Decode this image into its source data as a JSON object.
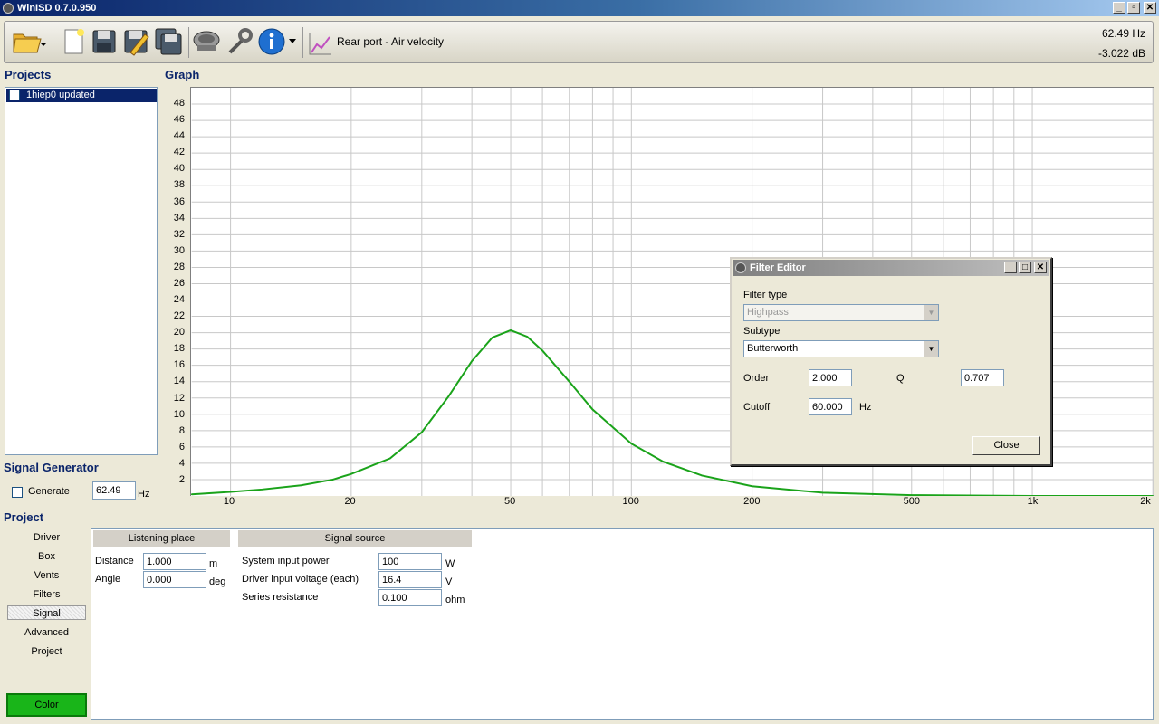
{
  "window": {
    "title": "WinISD 0.7.0.950"
  },
  "toolbar": {
    "graph_label": "Rear port - Air velocity",
    "freq_readout": "62.49 Hz",
    "db_readout": "-3.022 dB"
  },
  "projects": {
    "heading": "Projects",
    "items": [
      {
        "label": "1hiep0 updated",
        "checked": true
      }
    ]
  },
  "graph": {
    "heading": "Graph"
  },
  "chart_data": {
    "type": "line",
    "x_scale": "log",
    "xlim": [
      8,
      2000
    ],
    "ylim": [
      0,
      50
    ],
    "y_ticks": [
      2,
      4,
      6,
      8,
      10,
      12,
      14,
      16,
      18,
      20,
      22,
      24,
      26,
      28,
      30,
      32,
      34,
      36,
      38,
      40,
      42,
      44,
      46,
      48
    ],
    "x_tick_labels": [
      {
        "value": 10,
        "label": "10"
      },
      {
        "value": 20,
        "label": "20"
      },
      {
        "value": 50,
        "label": "50"
      },
      {
        "value": 100,
        "label": "100"
      },
      {
        "value": 200,
        "label": "200"
      },
      {
        "value": 500,
        "label": "500"
      },
      {
        "value": 1000,
        "label": "1k"
      },
      {
        "value": 2000,
        "label": "2k"
      }
    ],
    "grid": true,
    "series": [
      {
        "color": "#1aa31a",
        "x": [
          8,
          10,
          12,
          15,
          18,
          20,
          25,
          30,
          35,
          40,
          45,
          50,
          55,
          60,
          70,
          80,
          100,
          120,
          150,
          200,
          300,
          500,
          1000,
          2000
        ],
        "y": [
          0.2,
          0.5,
          0.8,
          1.3,
          2.0,
          2.7,
          4.6,
          7.8,
          12.2,
          16.5,
          19.4,
          20.3,
          19.5,
          17.8,
          14.0,
          10.6,
          6.4,
          4.2,
          2.5,
          1.2,
          0.4,
          0.1,
          0.0,
          0.0
        ]
      }
    ]
  },
  "signal_generator": {
    "heading": "Signal Generator",
    "generate_label": "Generate",
    "frequency": "62.49",
    "unit": "Hz"
  },
  "project": {
    "heading": "Project",
    "nav": [
      "Driver",
      "Box",
      "Vents",
      "Filters",
      "Signal",
      "Advanced",
      "Project"
    ],
    "selected": "Signal",
    "color_button": "Color",
    "color_swatch": "#19b519",
    "listening": {
      "header": "Listening place",
      "distance_label": "Distance",
      "distance": "1.000",
      "distance_unit": "m",
      "angle_label": "Angle",
      "angle": "0.000",
      "angle_unit": "deg"
    },
    "source": {
      "header": "Signal source",
      "power_label": "System input power",
      "power": "100",
      "power_unit": "W",
      "voltage_label": "Driver input voltage (each)",
      "voltage": "16.4",
      "voltage_unit": "V",
      "resistance_label": "Series resistance",
      "resistance": "0.100",
      "resistance_unit": "ohm"
    }
  },
  "filter_editor": {
    "title": "Filter Editor",
    "filter_type_label": "Filter type",
    "filter_type": "Highpass",
    "subtype_label": "Subtype",
    "subtype": "Butterworth",
    "order_label": "Order",
    "order": "2.000",
    "q_label": "Q",
    "q": "0.707",
    "cutoff_label": "Cutoff",
    "cutoff": "60.000",
    "cutoff_unit": "Hz",
    "close_label": "Close"
  }
}
